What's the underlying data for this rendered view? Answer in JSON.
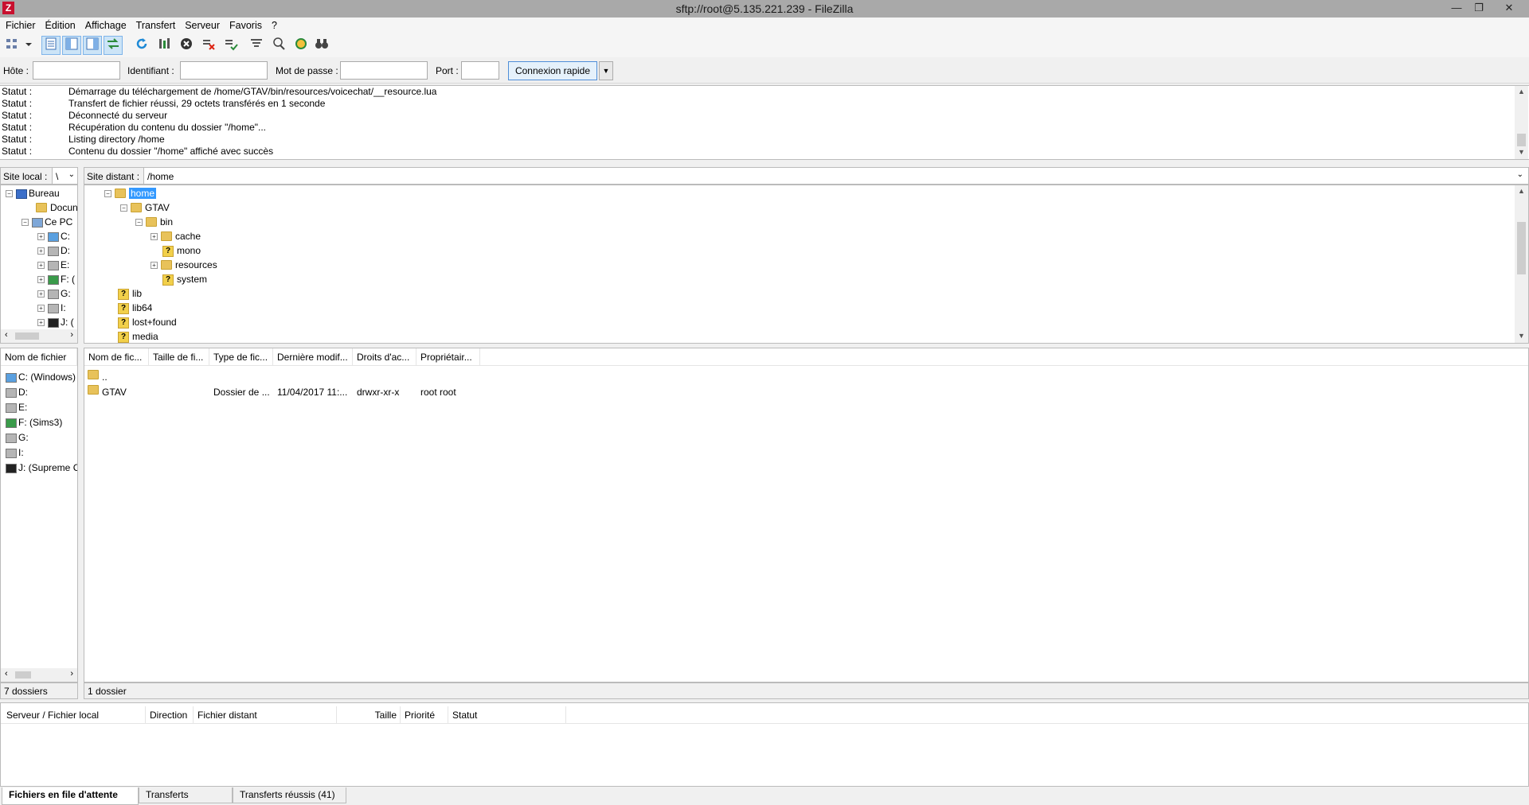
{
  "window": {
    "title": "sftp://root@5.135.221.239 - FileZilla",
    "app_icon": "Z",
    "controls": [
      "—",
      "❐",
      "✕"
    ]
  },
  "menu": [
    "Fichier",
    "Édition",
    "Affichage",
    "Transfert",
    "Serveur",
    "Favoris",
    "?"
  ],
  "quickconnect": {
    "host_label": "Hôte :",
    "user_label": "Identifiant :",
    "pass_label": "Mot de passe :",
    "port_label": "Port :",
    "host_value": "",
    "user_value": "",
    "pass_value": "",
    "port_value": "",
    "connect_button": "Connexion rapide",
    "dropdown": "▼"
  },
  "log": [
    {
      "k": "Statut :",
      "v": "Démarrage du téléchargement de /home/GTAV/bin/resources/voicechat/__resource.lua"
    },
    {
      "k": "Statut :",
      "v": "Transfert de fichier réussi, 29 octets transférés en 1 seconde"
    },
    {
      "k": "Statut :",
      "v": "Déconnecté du serveur"
    },
    {
      "k": "Statut :",
      "v": "Récupération du contenu du dossier \"/home\"..."
    },
    {
      "k": "Statut :",
      "v": "Listing directory /home"
    },
    {
      "k": "Statut :",
      "v": "Contenu du dossier \"/home\" affiché avec succès"
    }
  ],
  "local": {
    "path_label": "Site local :",
    "path_value": "\\",
    "tree": [
      "Bureau",
      "Docun",
      "Ce PC",
      "C:",
      "D:",
      "E:",
      "F: (",
      "G:",
      "I:",
      "J: ("
    ],
    "list_header": "Nom de fichier",
    "files": [
      "C: (Windows)",
      "D:",
      "E:",
      "F: (Sims3)",
      "G:",
      "I:",
      "J: (Supreme Cc"
    ],
    "status": "7 dossiers"
  },
  "remote": {
    "path_label": "Site distant :",
    "path_value": "/home",
    "tree": [
      "home",
      "GTAV",
      "bin",
      "cache",
      "mono",
      "resources",
      "system",
      "lib",
      "lib64",
      "lost+found",
      "media"
    ],
    "headers": [
      "Nom de fic...",
      "Taille de fi...",
      "Type de fic...",
      "Dernière modif...",
      "Droits d'ac...",
      "Propriétair..."
    ],
    "rows": [
      {
        "name": "..",
        "size": "",
        "type": "",
        "modified": "",
        "perms": "",
        "owner": ""
      },
      {
        "name": "GTAV",
        "size": "",
        "type": "Dossier de ...",
        "modified": "11/04/2017 11:...",
        "perms": "drwxr-xr-x",
        "owner": "root root"
      }
    ],
    "status": "1 dossier"
  },
  "queue": {
    "headers": [
      "Serveur / Fichier local",
      "Direction",
      "Fichier distant",
      "Taille",
      "Priorité",
      "Statut"
    ],
    "tabs": [
      "Fichiers en file d'attente",
      "Transferts échoués",
      "Transferts réussis (41)"
    ]
  }
}
